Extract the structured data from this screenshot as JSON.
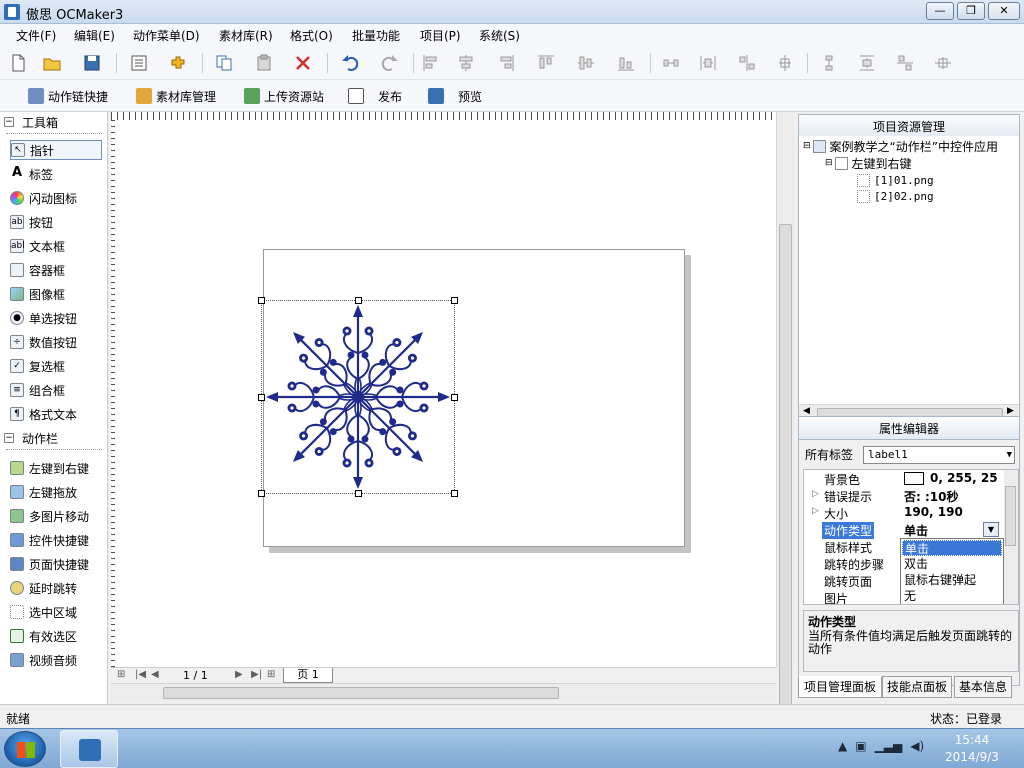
{
  "window": {
    "title": "傲思 OCMaker3",
    "min": "—",
    "max": "❐",
    "close": "✕"
  },
  "menu": [
    "文件(F)",
    "编辑(E)",
    "动作菜单(D)",
    "素材库(R)",
    "格式(O)",
    "批量功能",
    "项目(P)",
    "系统(S)"
  ],
  "toolbar2": [
    {
      "label": "动作链快捷",
      "icon": "action-chain-icon"
    },
    {
      "label": "素材库管理",
      "icon": "library-icon"
    },
    {
      "label": "上传资源站",
      "icon": "upload-icon"
    },
    {
      "label": "发布",
      "icon": "publish-icon"
    },
    {
      "label": "预览",
      "icon": "preview-icon"
    }
  ],
  "toolbox": {
    "title": "工具箱",
    "items": [
      "指针",
      "标签",
      "闪动图标",
      "按钮",
      "文本框",
      "容器框",
      "图像框",
      "单选按钮",
      "数值按钮",
      "复选框",
      "组合框",
      "格式文本"
    ],
    "actions_title": "动作栏",
    "actions": [
      "左键到右键",
      "左键拖放",
      "多图片移动",
      "控件快捷键",
      "页面快捷键",
      "延时跳转",
      "选中区域",
      "有效选区",
      "视频音频"
    ]
  },
  "pagebar": {
    "page_count": "1 / 1",
    "page_tab": "页 1"
  },
  "project": {
    "header": "项目资源管理",
    "root": "案例教学之“动作栏”中控件应用",
    "page": "左键到右键",
    "files": [
      "[1]01.png",
      "[2]02.png"
    ]
  },
  "properties": {
    "header": "属性编辑器",
    "tag_label": "所有标签",
    "tag_value": "label1",
    "rows": [
      {
        "name": "背景色",
        "value": "0, 255, 25"
      },
      {
        "name": "错误提示",
        "value": "否: :10秒"
      },
      {
        "name": "大小",
        "value": "190, 190"
      },
      {
        "name": "动作类型",
        "value": "单击"
      },
      {
        "name": "鼠标样式",
        "value": ""
      },
      {
        "name": "跳转的步骤",
        "value": ""
      },
      {
        "name": "跳转页面",
        "value": ""
      },
      {
        "name": "图片",
        "value": ""
      }
    ],
    "dropdown_options": [
      "单击",
      "双击",
      "鼠标右键弹起",
      "无"
    ],
    "desc_title": "动作类型",
    "desc_body": "当所有条件值均满足后触发页面跳转的动作"
  },
  "panel_tabs": [
    "项目管理面板",
    "技能点面板",
    "基本信息"
  ],
  "status": {
    "left": "就绪",
    "right": "状态：已登录"
  },
  "taskbar": {
    "time": "15:44",
    "date": "2014/9/3"
  },
  "colors": {
    "accent": "#3b78d8",
    "snowflake": "#1f2a8a"
  }
}
